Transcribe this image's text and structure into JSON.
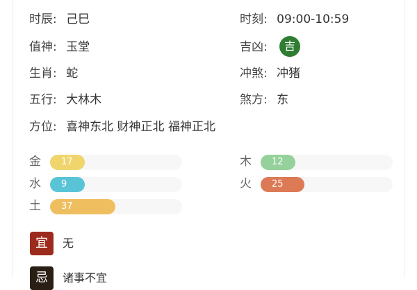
{
  "info": {
    "shichen_label": "时辰:",
    "shichen_value": "己巳",
    "shike_label": "时刻:",
    "shike_value": "09:00-10:59",
    "zhishen_label": "值神:",
    "zhishen_value": "玉堂",
    "jixiong_label": "吉凶:",
    "jixiong_value": "吉",
    "shengxiao_label": "生肖:",
    "shengxiao_value": "蛇",
    "chongsha_label": "冲煞:",
    "chongsha_value": "冲猪",
    "wuxing_label": "五行:",
    "wuxing_value": "大林木",
    "shafang_label": "煞方:",
    "shafang_value": "东",
    "fangwei_label": "方位:",
    "fangwei_value": "喜神东北 财神正北 福神正北"
  },
  "elements": [
    {
      "name": "金",
      "value": 17,
      "color": "#efd56b"
    },
    {
      "name": "木",
      "value": 12,
      "color": "#95d19a"
    },
    {
      "name": "水",
      "value": 9,
      "color": "#58c4d6"
    },
    {
      "name": "火",
      "value": 25,
      "color": "#dd7a56"
    },
    {
      "name": "土",
      "value": 37,
      "color": "#efbf5f"
    }
  ],
  "yi": {
    "char": "宜",
    "text": "无",
    "color": "#9c2b1d"
  },
  "ji": {
    "char": "忌",
    "text": "诸事不宜",
    "color": "#2a1f14"
  }
}
